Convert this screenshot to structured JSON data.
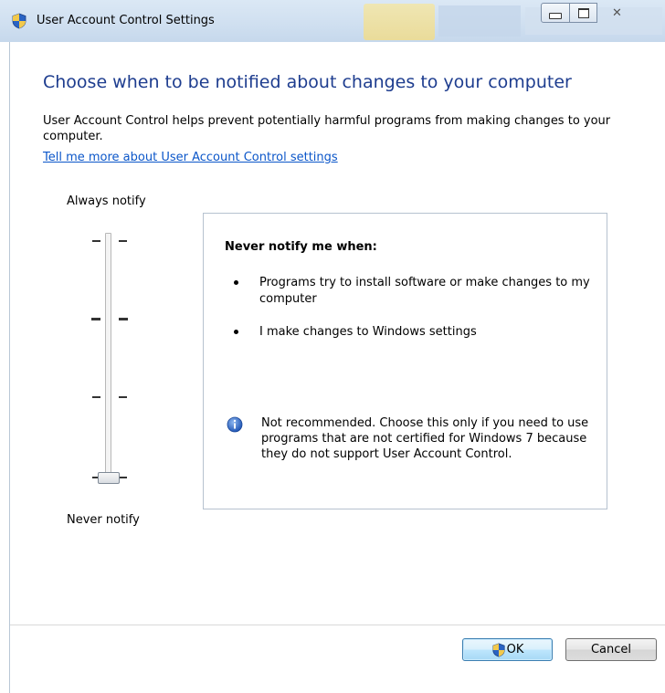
{
  "window": {
    "title": "User Account Control Settings",
    "icon": "uac-shield-icon",
    "controls": {
      "minimize": "minimize-icon",
      "maximize": "maximize-icon",
      "close": "close-icon",
      "close_glyph": "✕"
    }
  },
  "main": {
    "heading": "Choose when to be notified about changes to your computer",
    "description": "User Account Control helps prevent potentially harmful programs from making changes to your computer.",
    "help_link": "Tell me more about User Account Control settings"
  },
  "slider": {
    "top_label": "Always notify",
    "bottom_label": "Never notify",
    "levels": 4,
    "selected_level": 1,
    "selected_level_name": "Never notify"
  },
  "info_panel": {
    "title": "Never notify me when:",
    "bullets": [
      "Programs try to install software or make changes to my computer",
      "I make changes to Windows settings"
    ],
    "note": "Not recommended. Choose this only if you need to use programs that are not certified for Windows 7 because they do not support User Account Control.",
    "note_icon": "info-icon"
  },
  "buttons": {
    "ok": "OK",
    "cancel": "Cancel"
  },
  "colors": {
    "heading": "#1e3d8f",
    "link": "#0b56c9",
    "titlebar": "#cfdff0"
  }
}
